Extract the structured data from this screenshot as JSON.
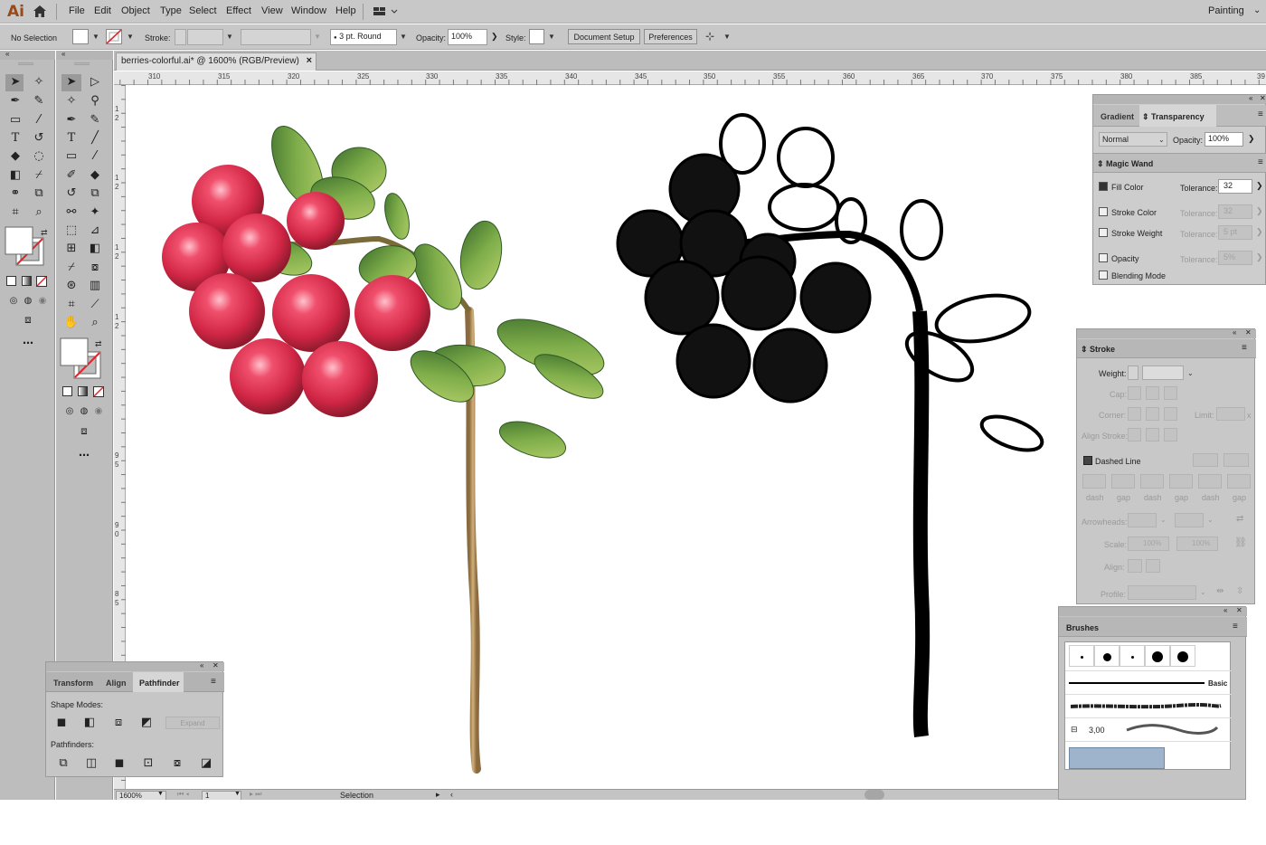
{
  "app": {
    "logo": "Ai",
    "workspace": "Painting"
  },
  "menu": [
    "File",
    "Edit",
    "Object",
    "Type",
    "Select",
    "Effect",
    "View",
    "Window",
    "Help"
  ],
  "control_bar": {
    "selection_status": "No Selection",
    "stroke_label": "Stroke:",
    "brush_value": "3 pt. Round",
    "opacity_label": "Opacity:",
    "opacity_value": "100%",
    "style_label": "Style:",
    "document_setup": "Document Setup",
    "preferences": "Preferences"
  },
  "document": {
    "tab_title": "berries-colorful.ai* @ 1600% (RGB/Preview)",
    "close": "×",
    "ruler_h": [
      "310",
      "315",
      "320",
      "325",
      "330",
      "335",
      "340",
      "345",
      "350",
      "355",
      "360",
      "365",
      "370",
      "375",
      "380",
      "385",
      "39"
    ],
    "ruler_v": [
      {
        "t": "1"
      },
      {
        "t": "2"
      },
      {
        "t": "1"
      },
      {
        "t": "2"
      },
      {
        "t": "1"
      },
      {
        "t": "2"
      },
      {
        "t": "1"
      },
      {
        "t": "2"
      },
      {
        "t": "9"
      },
      {
        "t": "5"
      },
      {
        "t": "9"
      },
      {
        "t": "0"
      },
      {
        "t": "8"
      },
      {
        "t": "5"
      }
    ]
  },
  "status": {
    "zoom": "1600%",
    "artboard": "1",
    "tool": "Selection"
  },
  "transparency_panel": {
    "tabs": [
      "Gradient",
      "Transparency"
    ],
    "blend_mode": "Normal",
    "opacity_label": "Opacity:",
    "opacity_value": "100%"
  },
  "magic_wand_panel": {
    "title": "Magic Wand",
    "rows": [
      {
        "label": "Fill Color",
        "checked": true,
        "tolerance_label": "Tolerance:",
        "value": "32",
        "enabled": true
      },
      {
        "label": "Stroke Color",
        "checked": false,
        "tolerance_label": "Tolerance:",
        "value": "32",
        "enabled": false
      },
      {
        "label": "Stroke Weight",
        "checked": false,
        "tolerance_label": "Tolerance:",
        "value": "5 pt",
        "enabled": false
      },
      {
        "label": "Opacity",
        "checked": false,
        "tolerance_label": "Tolerance:",
        "value": "5%",
        "enabled": false
      },
      {
        "label": "Blending Mode",
        "checked": false
      }
    ]
  },
  "stroke_panel": {
    "title": "Stroke",
    "weight_label": "Weight:",
    "cap_label": "Cap:",
    "corner_label": "Corner:",
    "limit_label": "Limit:",
    "limit_suffix": "x",
    "align_label": "Align Stroke:",
    "dashed_label": "Dashed Line",
    "dash_labels": [
      "dash",
      "gap",
      "dash",
      "gap",
      "dash",
      "gap"
    ],
    "arrowheads_label": "Arrowheads:",
    "scale_label": "Scale:",
    "scale_values": [
      "100%",
      "100%"
    ],
    "align2_label": "Align:",
    "profile_label": "Profile:"
  },
  "brushes_panel": {
    "title": "Brushes",
    "basic_label": "Basic",
    "size_value": "3,00"
  },
  "pathfinder_panel": {
    "tabs": [
      "Transform",
      "Align",
      "Pathfinder"
    ],
    "shape_modes_label": "Shape Modes:",
    "expand_label": "Expand",
    "pathfinders_label": "Pathfinders:"
  },
  "colors": {
    "berry": "#d9304f",
    "leaf": "#6a9a35",
    "stem": "#b08a55",
    "ui_bg": "#c8c8c8"
  }
}
